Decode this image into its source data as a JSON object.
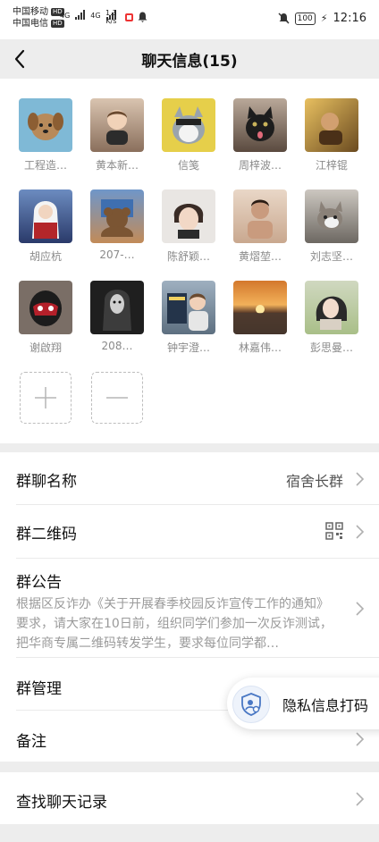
{
  "status_bar": {
    "carrier1": "中国移动",
    "carrier2": "中国电信",
    "hd": "HD",
    "net1": "4G",
    "net2": "4G",
    "speed_value": "1.3",
    "speed_unit": "K/s",
    "battery": "100",
    "time": "12:16"
  },
  "nav": {
    "title": "聊天信息(15)"
  },
  "members": [
    {
      "name": "工程造…",
      "color": "#7fb9d6"
    },
    {
      "name": "黄本新…",
      "color": "#c9a88d"
    },
    {
      "name": "信笺",
      "color": "#e6cf4a"
    },
    {
      "name": "周梓波…",
      "color": "#6e5a4c"
    },
    {
      "name": "江梓锟",
      "color": "#b08a4a"
    },
    {
      "name": "胡应杭",
      "color": "#9b2a2a"
    },
    {
      "name": "207-…",
      "color": "#7a6048"
    },
    {
      "name": "陈舒颖…",
      "color": "#4a3f3a"
    },
    {
      "name": "黄熠堃…",
      "color": "#c69a82"
    },
    {
      "name": "刘志坚…",
      "color": "#8e8a85"
    },
    {
      "name": "谢啟翔",
      "color": "#6b2a2a"
    },
    {
      "name": "208…",
      "color": "#2e2e2e"
    },
    {
      "name": "钟宇澄…",
      "color": "#8aa0b5"
    },
    {
      "name": "林嘉伟…",
      "color": "#d07a30"
    },
    {
      "name": "彭思曼…",
      "color": "#b7c99a"
    }
  ],
  "settings": {
    "group_name_label": "群聊名称",
    "group_name_value": "宿舍长群",
    "qr_label": "群二维码",
    "notice_label": "群公告",
    "notice_text": "根据区反诈办《关于开展春季校园反诈宣传工作的通知》要求，请大家在10日前，组织同学们参加一次反诈测试，把华商专属二维码转发学生，要求每位同学都…",
    "manage_label": "群管理",
    "remark_label": "备注",
    "search_label": "查找聊天记录"
  },
  "privacy_button": {
    "label": "隐私信息打码"
  }
}
